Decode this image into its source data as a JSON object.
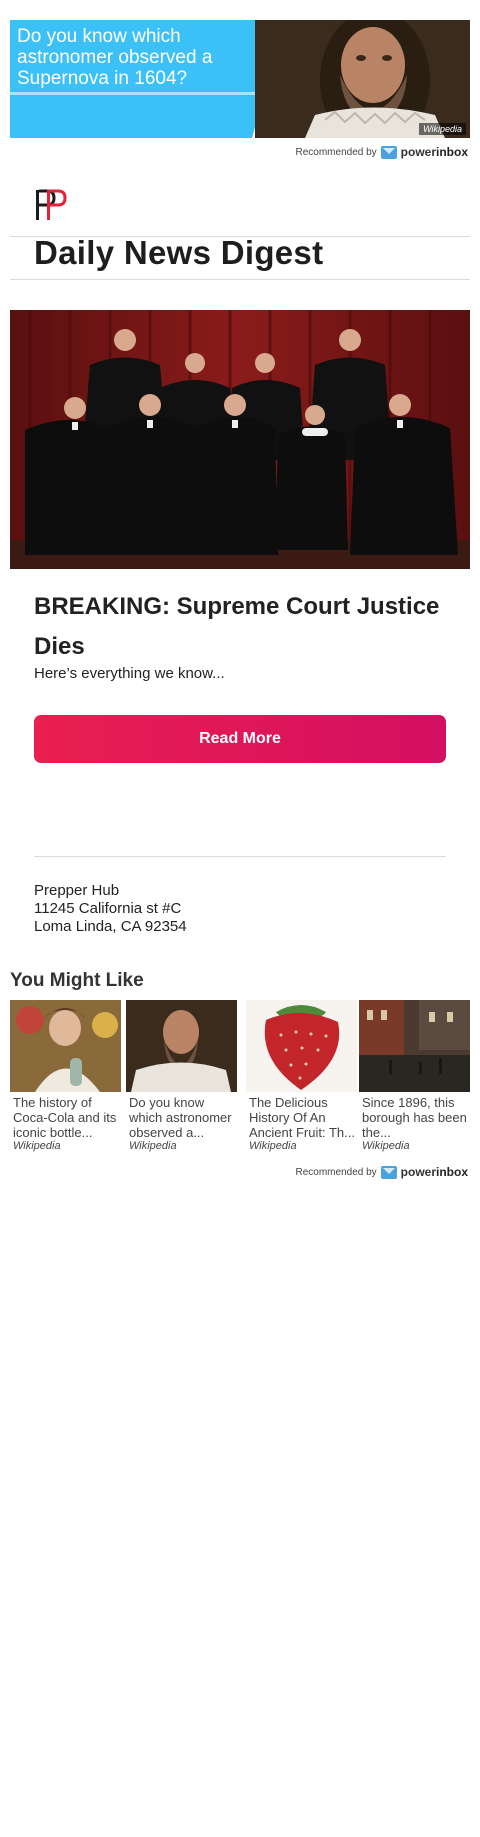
{
  "top_ad": {
    "headline": "Do you know which astronomer observed a Supernova in 1604?",
    "credit": "Wikipedia"
  },
  "recommended": {
    "label": "Recommended by",
    "brand_prefix": "power",
    "brand_suffix": "inbox"
  },
  "site": {
    "title": "Daily News Digest",
    "logo_colors": [
      "#1a1a1a",
      "#e4203b"
    ]
  },
  "article": {
    "headline": "BREAKING: Supreme Court Justice Dies",
    "subhead": "Here’s everything we know...",
    "cta_label": "Read More"
  },
  "address": {
    "name": "Prepper Hub",
    "street": "11245 California st #C",
    "city": "Loma Linda, CA 92354"
  },
  "you_might_like": {
    "heading": "You Might Like",
    "cards": [
      {
        "title": "The history of Coca-Cola and its iconic bottle...",
        "source": "Wikipedia"
      },
      {
        "title": "Do you know which astronomer observed a...",
        "source": "Wikipedia"
      },
      {
        "title": "The Delicious History Of An Ancient Fruit: Th...",
        "source": "Wikipedia"
      },
      {
        "title": "Since 1896, this borough has been the...",
        "source": "Wikipedia"
      }
    ]
  },
  "colors": {
    "accent": "#e91f50",
    "ad_blue": "#3cc0f8"
  }
}
